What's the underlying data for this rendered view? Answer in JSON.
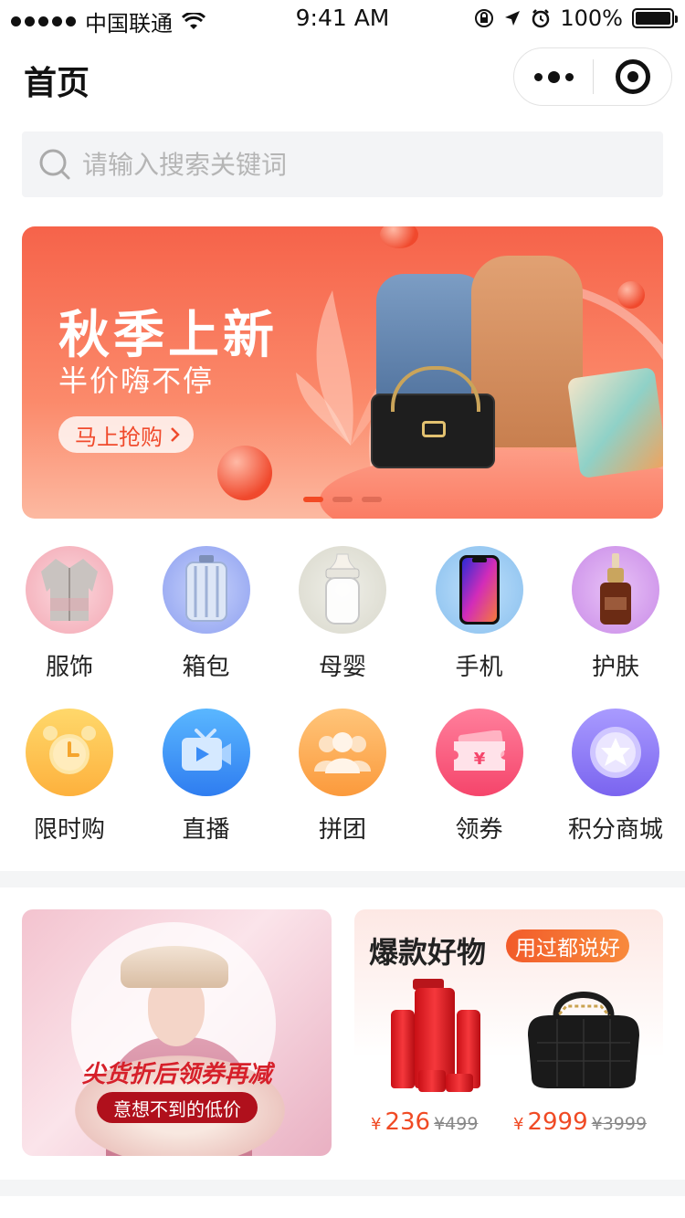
{
  "status_bar": {
    "carrier": "中国联通",
    "time": "9:41 AM",
    "battery": "100%"
  },
  "nav": {
    "title": "首页"
  },
  "search": {
    "placeholder": "请输入搜索关键词"
  },
  "banner": {
    "title": "秋季上新",
    "subtitle": "半价嗨不停",
    "cta": "马上抢购",
    "slide_count": 3,
    "active_slide": 1
  },
  "categories": [
    {
      "label": "服饰",
      "icon": "clothing-icon"
    },
    {
      "label": "箱包",
      "icon": "luggage-icon"
    },
    {
      "label": "母婴",
      "icon": "baby-bottle-icon"
    },
    {
      "label": "手机",
      "icon": "phone-icon"
    },
    {
      "label": "护肤",
      "icon": "skincare-icon"
    },
    {
      "label": "限时购",
      "icon": "alarm-clock-icon"
    },
    {
      "label": "直播",
      "icon": "live-tv-icon"
    },
    {
      "label": "拼团",
      "icon": "group-icon"
    },
    {
      "label": "领券",
      "icon": "coupon-icon"
    },
    {
      "label": "积分商城",
      "icon": "points-star-icon"
    }
  ],
  "promo_left": {
    "headline": "尖货折后领券再减",
    "badge": "意想不到的低价"
  },
  "promo_right": {
    "title": "爆款好物",
    "tag": "用过都说好",
    "products": [
      {
        "currency": "¥",
        "price": "236",
        "original": "¥499"
      },
      {
        "currency": "¥",
        "price": "2999",
        "original": "¥3999"
      }
    ]
  },
  "colors": {
    "accent": "#f04a24",
    "banner_top": "#f6634a"
  }
}
